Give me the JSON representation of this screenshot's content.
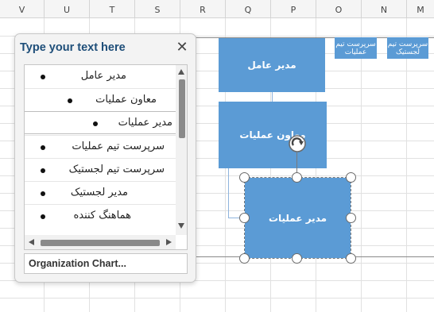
{
  "columns": [
    "V",
    "U",
    "T",
    "S",
    "R",
    "Q",
    "P",
    "O",
    "N",
    "M"
  ],
  "text_pane": {
    "title": "Type your text here",
    "close_glyph": "✕",
    "items": [
      {
        "text": "مدیر عامل",
        "level": 1
      },
      {
        "text": "معاون عملیات",
        "level": 2
      },
      {
        "text": "مدیر عملیات",
        "level": 3
      },
      {
        "text": "سرپرست تیم عملیات",
        "level": 1
      },
      {
        "text": "سرپرست تیم لجستیک",
        "level": 1
      },
      {
        "text": "مدیر لجستیک",
        "level": 1
      },
      {
        "text": "هماهنگ کننده",
        "level": 1
      }
    ],
    "selected_index": 2,
    "footer": "Organization Chart..."
  },
  "org_chart": {
    "top_node": "مدیر عامل",
    "middle_node": "معاون عملیات",
    "selected_node": "مدیر عملیات",
    "small_node_1": "سرپرست تیم عملیات",
    "small_node_2": "سرپرست تیم لجستیک",
    "shape_color": "#5b9bd5"
  },
  "icons": {
    "rotate_handle": "rotate-icon",
    "bullet": "bullet-icon",
    "scroll_up": "scroll-up-icon",
    "scroll_down": "scroll-down-icon",
    "scroll_left": "scroll-left-icon",
    "scroll_right": "scroll-right-icon"
  }
}
